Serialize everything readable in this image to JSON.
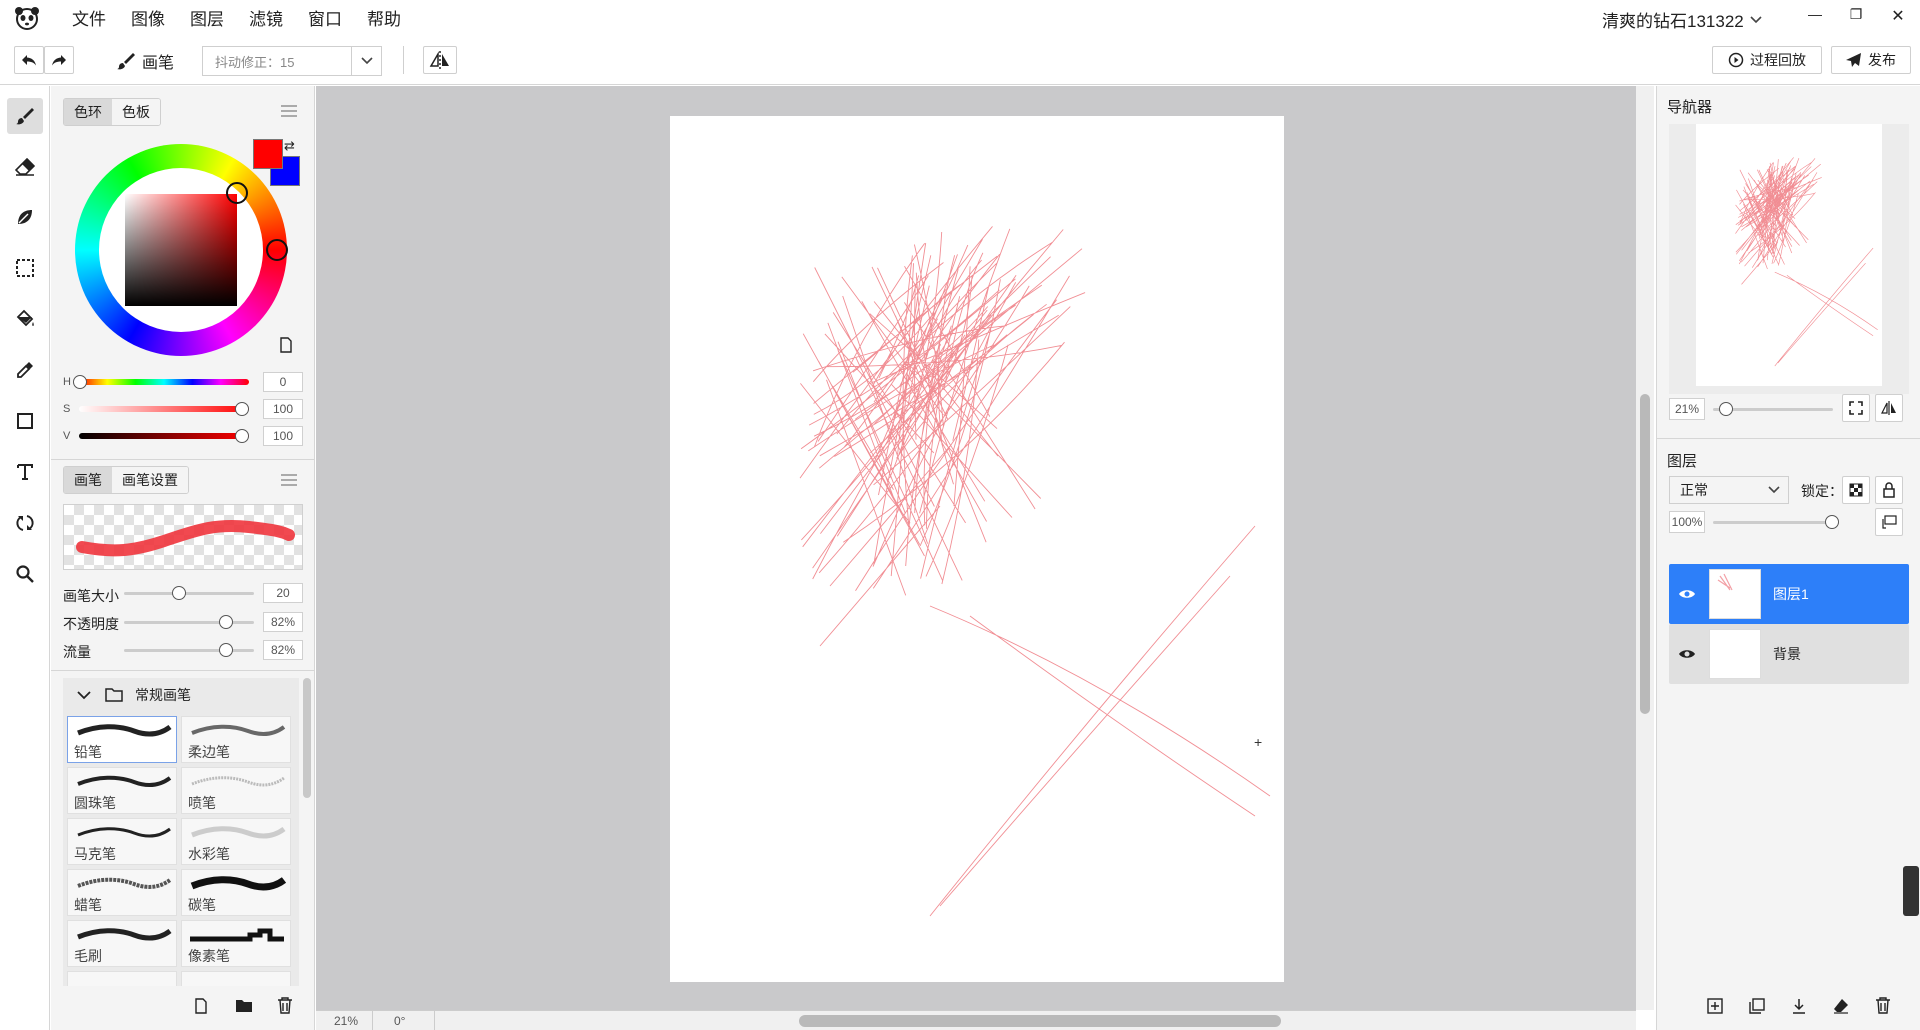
{
  "menu": {
    "items": [
      "文件",
      "图像",
      "图层",
      "滤镜",
      "窗口",
      "帮助"
    ]
  },
  "user": {
    "name": "清爽的钻石131322"
  },
  "toolbar": {
    "brush_label": "画笔",
    "smoothing": "抖动修正：15",
    "replay_label": "过程回放",
    "publish_label": "发布"
  },
  "color_panel": {
    "tabs": [
      "色环",
      "色板"
    ],
    "active_tab": "色环",
    "primary_color": "#ff0000",
    "secondary_color": "#0000ff",
    "h_label": "H",
    "h_value": "0",
    "s_label": "S",
    "s_value": "100",
    "v_label": "V",
    "v_value": "100"
  },
  "brush_panel": {
    "tabs": [
      "画笔",
      "画笔设置"
    ],
    "active_tab": "画笔",
    "size_label": "画笔大小",
    "size_value": "20",
    "opacity_label": "不透明度",
    "opacity_value": "82%",
    "flow_label": "流量",
    "flow_value": "82%",
    "group_name": "常规画笔",
    "brushes": [
      "铅笔",
      "柔边笔",
      "圆珠笔",
      "喷笔",
      "马克笔",
      "水彩笔",
      "蜡笔",
      "碳笔",
      "毛刷",
      "像素笔"
    ],
    "selected": "铅笔"
  },
  "status": {
    "zoom": "21%",
    "angle": "0°"
  },
  "navigator": {
    "title": "导航器",
    "zoom": "21%"
  },
  "layers_panel": {
    "title": "图层",
    "blend_mode": "正常",
    "lock_label": "锁定：",
    "opacity": "100%",
    "layers": [
      {
        "name": "图层1",
        "selected": true
      },
      {
        "name": "背景",
        "selected": false
      }
    ]
  },
  "colors": {
    "accent": "#2d7ff9",
    "stroke": "#e8434d"
  }
}
